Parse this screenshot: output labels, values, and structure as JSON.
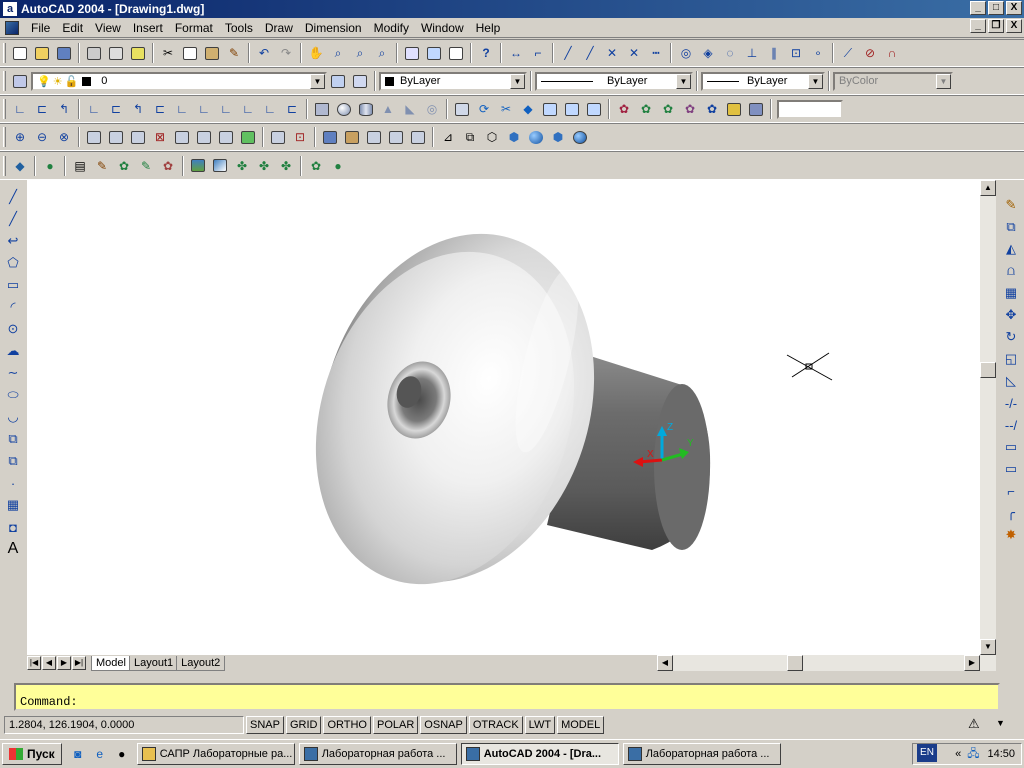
{
  "window": {
    "title": "AutoCAD 2004 - [Drawing1.dwg]",
    "app_icon": "a"
  },
  "window_buttons": {
    "minimize": "_",
    "maximize": "□",
    "close": "X",
    "doc_minimize": "_",
    "doc_restore": "❐",
    "doc_close": "X"
  },
  "menu": [
    "File",
    "Edit",
    "View",
    "Insert",
    "Format",
    "Tools",
    "Draw",
    "Dimension",
    "Modify",
    "Window",
    "Help"
  ],
  "layer_toolbar": {
    "layer_name": "0"
  },
  "properties_toolbar": {
    "color": "ByLayer",
    "linetype": "ByLayer",
    "lineweight": "ByLayer",
    "plotstyle": "ByColor"
  },
  "layout_tabs": [
    "Model",
    "Layout1",
    "Layout2"
  ],
  "command_line": {
    "prompt": "Command:"
  },
  "status": {
    "coordinates": "1.2804, 126.1904, 0.0000",
    "toggles": [
      "SNAP",
      "GRID",
      "ORTHO",
      "POLAR",
      "OSNAP",
      "OTRACK",
      "LWT",
      "MODEL"
    ]
  },
  "taskbar": {
    "start_label": "Пуск",
    "tasks": [
      "САПР Лабораторные ра...",
      "Лабораторная работа ...",
      "AutoCAD 2004 - [Dra...",
      "Лабораторная работа ..."
    ],
    "language": "EN",
    "clock": "14:50"
  },
  "ucs_icon": {
    "x_label": "X",
    "y_label": "Y",
    "z_label": "Z"
  },
  "colors": {
    "titlebar": "#0a246a",
    "command_bg": "#ffff99",
    "canvas_bg": "#ffffff",
    "taskbar_bg": "#d4d0c8"
  },
  "icons": {
    "left_toolbar": [
      "line-icon",
      "construction-line-icon",
      "polyline-icon",
      "polygon-icon",
      "rectangle-icon",
      "arc-icon",
      "circle-icon",
      "revision-cloud-icon",
      "spline-icon",
      "ellipse-icon",
      "ellipse-arc-icon",
      "insert-block-icon",
      "make-block-icon",
      "point-icon",
      "hatch-icon",
      "region-icon",
      "multiline-text-icon"
    ],
    "right_toolbar": [
      "erase-icon",
      "copy-icon",
      "mirror-icon",
      "offset-icon",
      "array-icon",
      "move-icon",
      "rotate-icon",
      "scale-icon",
      "stretch-icon",
      "trim-icon",
      "extend-icon",
      "break-at-point-icon",
      "break-icon",
      "chamfer-icon",
      "fillet-icon",
      "explode-icon"
    ]
  }
}
